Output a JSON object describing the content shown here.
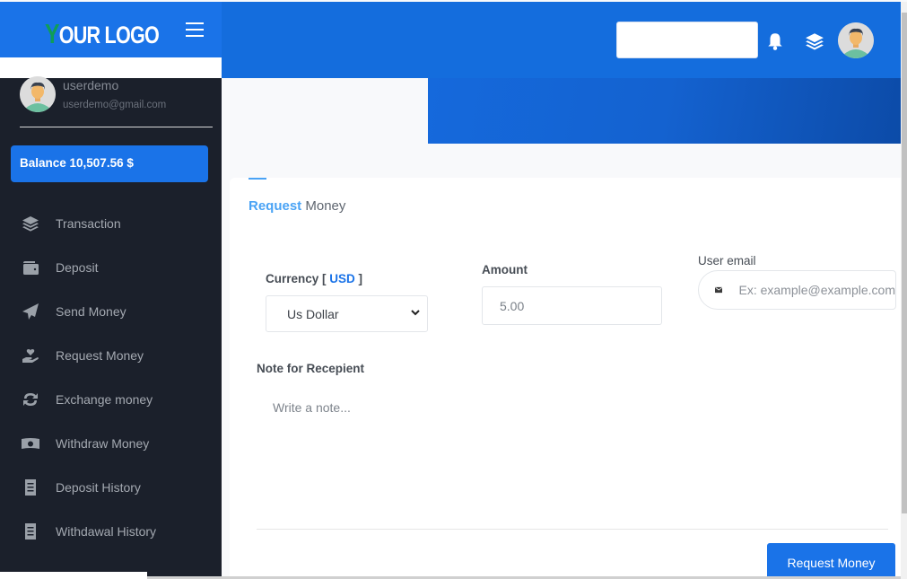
{
  "brand": {
    "logo_first": "Y",
    "logo_rest": "OUR LOGO",
    "accent": "#1a73e8",
    "logo_y_color": "#0f9d58"
  },
  "user": {
    "name": "userdemo",
    "email": "userdemo@gmail.com"
  },
  "balance": "Balance 10,507.56 $",
  "sidebar": {
    "items": [
      {
        "label": "Transaction",
        "icon": "layers-icon"
      },
      {
        "label": "Deposit",
        "icon": "wallet-icon"
      },
      {
        "label": "Send Money",
        "icon": "paper-plane-icon"
      },
      {
        "label": "Request Money",
        "icon": "hand-heart-icon"
      },
      {
        "label": "Exchange money",
        "icon": "sync-icon"
      },
      {
        "label": "Withdraw Money",
        "icon": "money-bill-icon"
      },
      {
        "label": "Deposit History",
        "icon": "receipt-icon"
      },
      {
        "label": "Withdawal History",
        "icon": "receipt-icon"
      }
    ]
  },
  "header": {
    "search_value": ""
  },
  "page": {
    "title_highlight": "Request",
    "title_rest": " Money",
    "currency_label": "Currency [ ",
    "currency_code": "USD",
    "currency_label_end": " ]",
    "currency_selected": "Us Dollar",
    "amount_label": "Amount",
    "amount_value": "5.00",
    "email_label": "User email",
    "email_placeholder": "Ex: example@example.com",
    "note_label": "Note for Recepient",
    "note_placeholder": "Write a note...",
    "submit_label": "Request Money"
  }
}
